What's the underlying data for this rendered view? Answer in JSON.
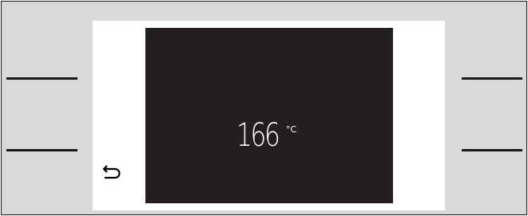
{
  "display": {
    "temperature": "166",
    "unit": "°C"
  },
  "icons": {
    "back": "back-arrow-icon"
  },
  "colors": {
    "frame": "#d9d9d9",
    "panel": "#ffffff",
    "screen": "#231f20",
    "text": "#ffffff",
    "lines": "#1a1a1a"
  }
}
